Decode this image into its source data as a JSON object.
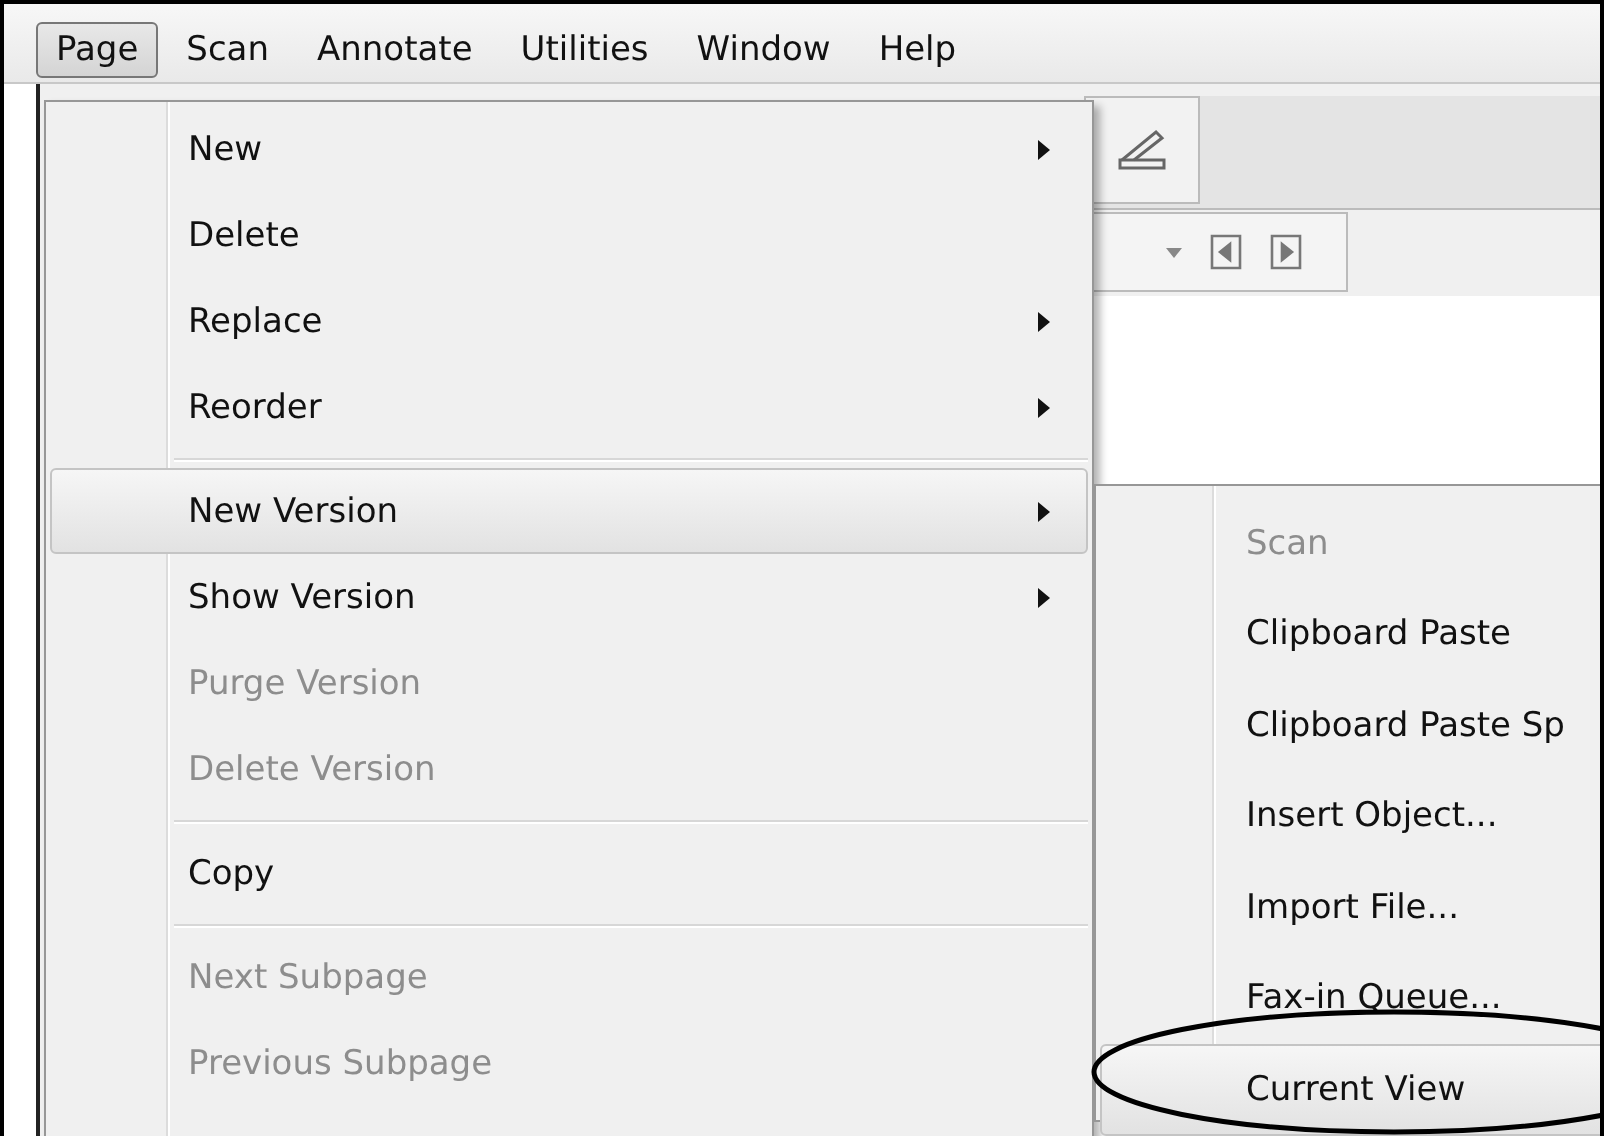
{
  "menubar": [
    {
      "label": "Page",
      "selected": true
    },
    {
      "label": "Scan",
      "selected": false
    },
    {
      "label": "Annotate",
      "selected": false
    },
    {
      "label": "Utilities",
      "selected": false
    },
    {
      "label": "Window",
      "selected": false
    },
    {
      "label": "Help",
      "selected": false
    }
  ],
  "page_menu": [
    {
      "kind": "item",
      "label": "New",
      "disabled": false,
      "submenu": true,
      "selected": false
    },
    {
      "kind": "item",
      "label": "Delete",
      "disabled": false,
      "submenu": false,
      "selected": false
    },
    {
      "kind": "item",
      "label": "Replace",
      "disabled": false,
      "submenu": true,
      "selected": false
    },
    {
      "kind": "item",
      "label": "Reorder",
      "disabled": false,
      "submenu": true,
      "selected": false
    },
    {
      "kind": "separator"
    },
    {
      "kind": "item",
      "label": "New Version",
      "disabled": false,
      "submenu": true,
      "selected": true
    },
    {
      "kind": "item",
      "label": "Show Version",
      "disabled": false,
      "submenu": true,
      "selected": false
    },
    {
      "kind": "item",
      "label": "Purge Version",
      "disabled": true,
      "submenu": false,
      "selected": false
    },
    {
      "kind": "item",
      "label": "Delete Version",
      "disabled": true,
      "submenu": false,
      "selected": false
    },
    {
      "kind": "separator"
    },
    {
      "kind": "item",
      "label": "Copy",
      "disabled": false,
      "submenu": false,
      "selected": false
    },
    {
      "kind": "separator"
    },
    {
      "kind": "item",
      "label": "Next Subpage",
      "disabled": true,
      "submenu": false,
      "selected": false
    },
    {
      "kind": "item",
      "label": "Previous Subpage",
      "disabled": true,
      "submenu": false,
      "selected": false
    }
  ],
  "new_version_submenu": [
    {
      "label": "Scan",
      "disabled": true,
      "selected": false
    },
    {
      "label": "Clipboard Paste",
      "disabled": false,
      "selected": false
    },
    {
      "label": "Clipboard Paste Sp",
      "disabled": false,
      "selected": false
    },
    {
      "label": "Insert Object...",
      "disabled": false,
      "selected": false
    },
    {
      "label": "Import File...",
      "disabled": false,
      "selected": false
    },
    {
      "label": "Fax-in Queue...",
      "disabled": false,
      "selected": false
    },
    {
      "label": "Current View",
      "disabled": false,
      "selected": true
    }
  ]
}
